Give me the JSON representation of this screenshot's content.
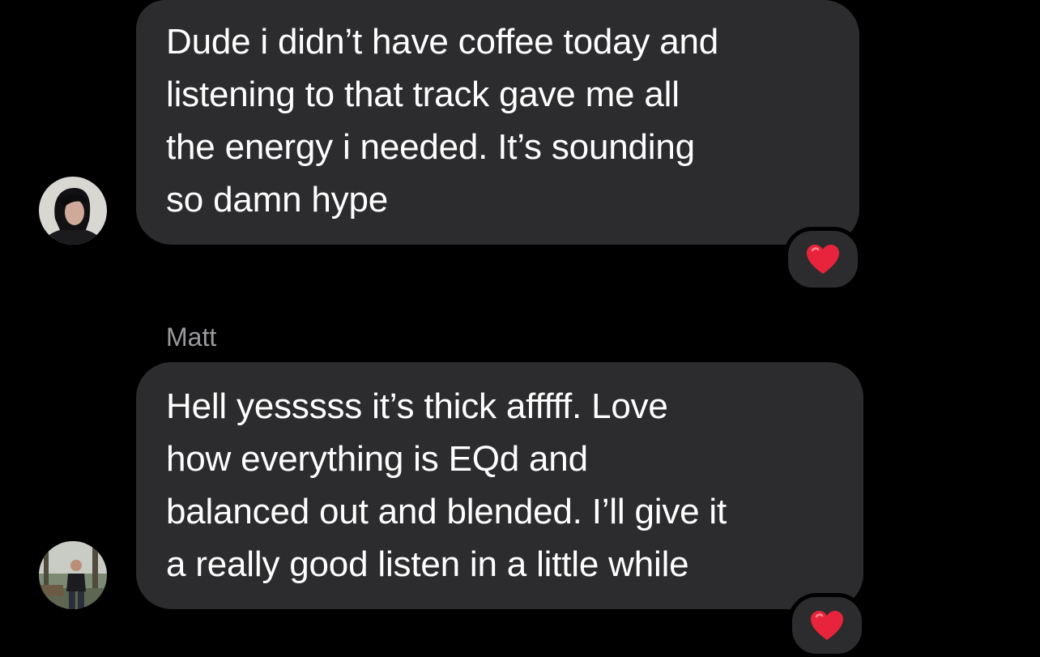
{
  "messages": [
    {
      "sender": "",
      "avatar_icon": "avatar-icon",
      "lines": [
        "Dude i didn’t have coffee today and",
        "listening to that track gave me all",
        "the energy i needed. It’s sounding",
        "so damn hype"
      ],
      "reaction": "heart"
    },
    {
      "sender": "Matt",
      "avatar_icon": "avatar-icon",
      "lines": [
        "Hell yesssss it’s thick afffff. Love",
        "how everything is EQd and",
        "balanced out and blended. I’ll give it",
        "a really good listen in a little while"
      ],
      "reaction": "heart"
    }
  ],
  "colors": {
    "background": "#000000",
    "bubble": "#2c2c2e",
    "text": "#ffffff",
    "sender_name": "#9a9a9e",
    "heart": "#e0245e"
  }
}
